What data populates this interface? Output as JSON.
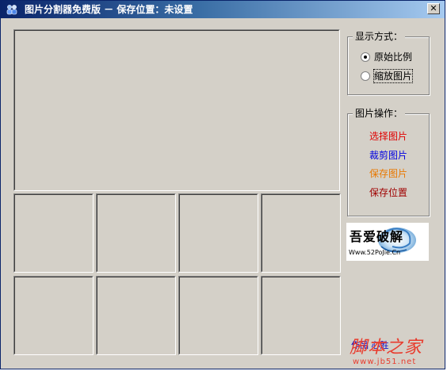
{
  "window": {
    "title": "图片分割器免费版 － 保存位置：未设置",
    "close_symbol": "✕"
  },
  "display_mode": {
    "legend": "显示方式：",
    "options": [
      {
        "label": "原始比例",
        "selected": true
      },
      {
        "label": "缩放图片",
        "selected": false
      }
    ]
  },
  "image_ops": {
    "legend": "图片操作：",
    "links": [
      {
        "label": "选择图片",
        "color": "#e00000"
      },
      {
        "label": "裁剪图片",
        "color": "#0000e0"
      },
      {
        "label": "保存图片",
        "color": "#e87800"
      },
      {
        "label": "保存位置",
        "color": "#a00000"
      }
    ]
  },
  "logo": {
    "text_main": "吾爱破解",
    "text_sub": "Www.52PoJie.Cn"
  },
  "footer": {
    "link_text": "作品  心胜"
  },
  "watermark": {
    "text_cn": "脚本之家",
    "text_url": "www.jb51.net"
  },
  "colors": {
    "face": "#d4d0c8",
    "titlebar_start": "#0a246a",
    "titlebar_end": "#a6caf0"
  }
}
